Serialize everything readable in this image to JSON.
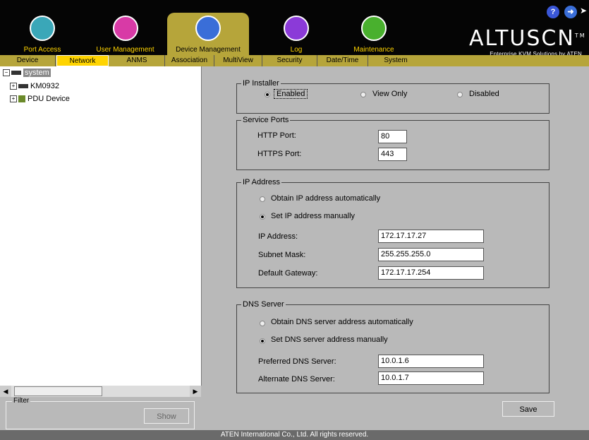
{
  "header": {
    "modules": [
      {
        "label": "Port Access",
        "icon": "monitor-hand-icon",
        "color": "#3aa7b8"
      },
      {
        "label": "User Management",
        "icon": "users-icon",
        "color": "#d83aa6"
      },
      {
        "label": "Device Management",
        "icon": "device-gear-icon",
        "color": "#3a6ed8"
      },
      {
        "label": "Log",
        "icon": "log-icon",
        "color": "#8b3ad8"
      },
      {
        "label": "Maintenance",
        "icon": "wrench-icon",
        "color": "#49b02e"
      }
    ],
    "brand": "ALTUSCN",
    "brand_tm": "TM",
    "brand_tagline": "Enterprise KVM Solutions by ATEN",
    "help_icon": "help-icon",
    "logout_icon": "logout-icon"
  },
  "tabs": [
    "Device",
    "Network",
    "ANMS",
    "Association",
    "MultiView",
    "Security",
    "Date/Time",
    "System"
  ],
  "selected_tab": "Network",
  "tree": {
    "root": "system",
    "children": [
      "KM0932",
      "PDU Device"
    ]
  },
  "filter": {
    "label": "Filter",
    "show_button": "Show"
  },
  "ip_installer": {
    "legend": "IP Installer",
    "options": [
      "Enabled",
      "View Only",
      "Disabled"
    ],
    "selected": "Enabled"
  },
  "service_ports": {
    "legend": "Service Ports",
    "http_label": "HTTP Port:",
    "http_value": "80",
    "https_label": "HTTPS Port:",
    "https_value": "443"
  },
  "ip_address": {
    "legend": "IP Address",
    "auto_option": "Obtain IP address automatically",
    "manual_option": "Set IP address manually",
    "selected": "manual",
    "ip_label": "IP Address:",
    "ip_value": "172.17.17.27",
    "mask_label": "Subnet Mask:",
    "mask_value": "255.255.255.0",
    "gw_label": "Default Gateway:",
    "gw_value": "172.17.17.254"
  },
  "dns": {
    "legend": "DNS Server",
    "auto_option": "Obtain DNS server address automatically",
    "manual_option": "Set DNS server address manually",
    "selected": "manual",
    "pref_label": "Preferred DNS Server:",
    "pref_value": "10.0.1.6",
    "alt_label": "Alternate DNS Server:",
    "alt_value": "10.0.1.7"
  },
  "save_button": "Save",
  "footer": "ATEN International Co., Ltd. All rights reserved."
}
